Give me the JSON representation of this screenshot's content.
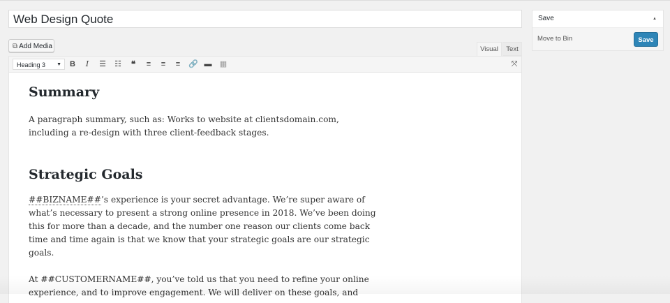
{
  "post": {
    "title": "Web Design Quote"
  },
  "media": {
    "add_media_label": "Add Media",
    "icon": "media-icon"
  },
  "tabs": {
    "visual": "Visual",
    "text": "Text"
  },
  "toolbar": {
    "format": "Heading 3",
    "buttons": [
      "bold",
      "italic",
      "bulleted-list",
      "numbered-list",
      "blockquote",
      "align-left",
      "align-center",
      "align-right",
      "link",
      "read-more",
      "toolbar-toggle"
    ],
    "bold_glyph": "B",
    "italic_glyph": "I",
    "quote_glyph": "66"
  },
  "content": {
    "h1": "Summary",
    "p1": [
      "A paragraph summary, such as: Works to website at clientsdomain.com,",
      "including a re-design with three client-feedback stages."
    ],
    "h2": "Strategic Goals",
    "p2_token": "##BIZNAME##",
    "p2_first_rest": "’s experience is your secret advantage. We’re super aware of",
    "p2": [
      "what’s necessary to present a strong online presence in 2018. We’ve been doing",
      "this for more than a decade, and the number one reason our clients come back",
      "time and time again is that we know that your strategic goals are our strategic",
      "goals."
    ],
    "p3": [
      "At ##CUSTOMERNAME##, you’ve told us that you need to refine your online",
      "experience, and to improve engagement. We will deliver on these goals, and"
    ]
  },
  "publish": {
    "header": "Save",
    "move_to_bin": "Move to Bin",
    "save_button": "Save",
    "accent": "#2e85b7"
  }
}
